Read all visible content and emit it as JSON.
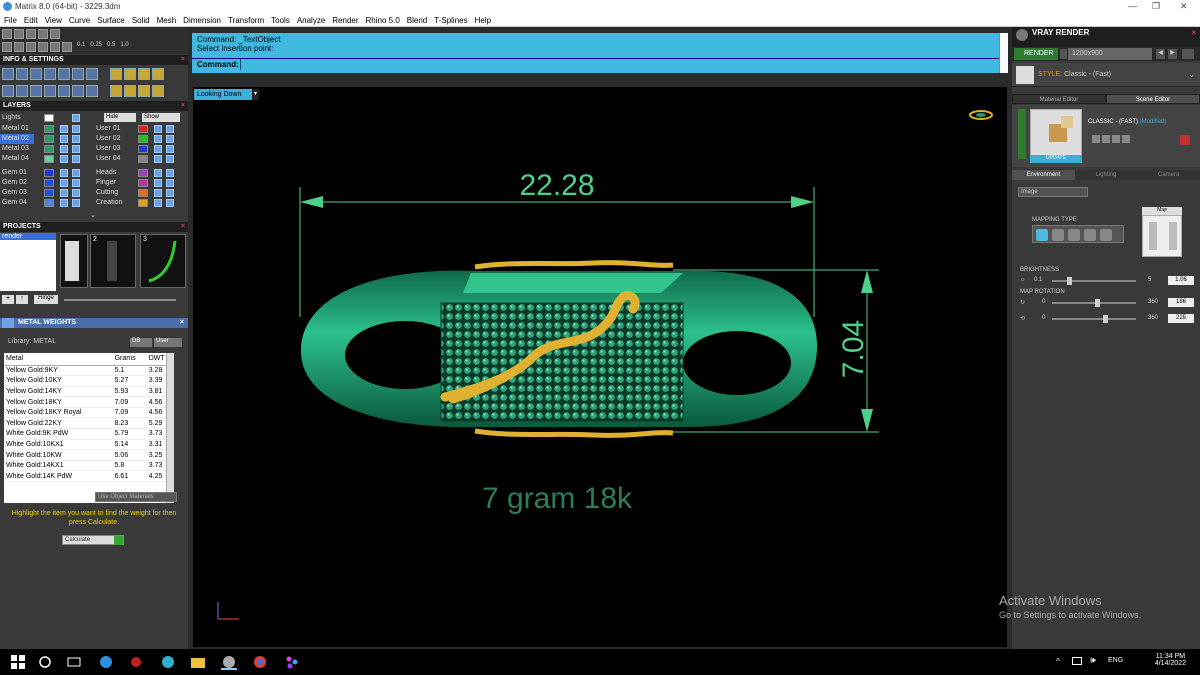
{
  "window": {
    "title": "Matrix 8.0 (64-bit) - 3229.3dm"
  },
  "menu": [
    "File",
    "Edit",
    "View",
    "Curve",
    "Surface",
    "Solid",
    "Mesh",
    "Dimension",
    "Transform",
    "Tools",
    "Analyze",
    "Render",
    "Rhino 5.0",
    "Blend",
    "T-Splines",
    "Help"
  ],
  "toolbar_values": [
    "0.1",
    "0.25",
    "0.5",
    "1.0"
  ],
  "info_panel": {
    "title": "INFO & SETTINGS"
  },
  "layers": {
    "title": "LAYERS",
    "header": [
      "Lights",
      "Hide",
      "Show"
    ],
    "rows": [
      {
        "left": "Metal 01",
        "right": "User 01",
        "lcolor": "#2e9a6a",
        "rcolor": "#e02020"
      },
      {
        "left": "Metal 02",
        "right": "User 02",
        "lcolor": "#2e9a6a",
        "rcolor": "#20c020",
        "selected": true
      },
      {
        "left": "Metal 03",
        "right": "User 03",
        "lcolor": "#2e9a6a",
        "rcolor": "#1e3adb"
      },
      {
        "left": "Metal 04",
        "right": "User 04",
        "lcolor": "#6ad0a0",
        "rcolor": "#888888"
      },
      {
        "left": "Gem 01",
        "right": "Heads",
        "lcolor": "#1e3adb",
        "rcolor": "#9a40c0"
      },
      {
        "left": "Gem 02",
        "right": "Finger",
        "lcolor": "#2050e0",
        "rcolor": "#c030a0"
      },
      {
        "left": "Gem 03",
        "right": "Cutting",
        "lcolor": "#2050e0",
        "rcolor": "#e07020"
      },
      {
        "left": "Gem 04",
        "right": "Creation",
        "lcolor": "#5080e0",
        "rcolor": "#e0a020"
      }
    ]
  },
  "projects": {
    "title": "PROJECTS",
    "items": [
      "render"
    ],
    "thumbs": [
      "1",
      "2",
      "3"
    ],
    "button": "Hinge"
  },
  "metal_weights": {
    "title": "METAL WEIGHTS",
    "library": "Library: METAL",
    "buttons": [
      "DB",
      "User"
    ],
    "columns": [
      "Metal",
      "Grams",
      "DWT"
    ],
    "rows": [
      [
        "Yellow Gold:9KY",
        "5.1",
        "3.28"
      ],
      [
        "Yellow Gold:10KY",
        "5.27",
        "3.39"
      ],
      [
        "Yellow Gold:14KY",
        "5.93",
        "3.81"
      ],
      [
        "Yellow Gold:18KY",
        "7.09",
        "4.56"
      ],
      [
        "Yellow Gold:18KY Royal",
        "7.09",
        "4.56"
      ],
      [
        "Yellow Gold:22KY",
        "8.23",
        "5.29"
      ],
      [
        "White Gold:9K PdW",
        "5.79",
        "3.73"
      ],
      [
        "White Gold:10KX1",
        "5.14",
        "3.31"
      ],
      [
        "White Gold:10KW",
        "5.06",
        "3.25"
      ],
      [
        "White Gold:14KX1",
        "5.8",
        "3.73"
      ],
      [
        "White Gold:14K PdW",
        "6.61",
        "4.25"
      ]
    ],
    "use_object_materials": "Use Object Materials",
    "hint": "Highlight the item you want to find the weight for then press Calculate.",
    "calculate": "Calculate"
  },
  "command": {
    "line1": "Command: _TextObject",
    "line2": "Select insertion point:",
    "label": "Command:",
    "value": ""
  },
  "viewport": {
    "tab": "Looking Down",
    "dim_width": "22.28",
    "dim_height": "7.04",
    "annotation": "7 gram 18k"
  },
  "vray": {
    "title": "VRAY RENDER",
    "render_btn": "RENDER",
    "resolution": "1200x900",
    "style_label": "STYLE:",
    "style_value": "Classic - (Fast)",
    "tabs": [
      "Material Editor",
      "Scene Editor"
    ],
    "active_tab": "Scene Editor",
    "material_name": "CLASSIC - (FAST)",
    "material_state": "(Modified)",
    "update": "UPDATE",
    "env_tabs": [
      "Environment",
      "Lighting",
      "Camera"
    ],
    "env_type": "Image",
    "mapping_type": "MAPPING TYPE",
    "map_label": "Map",
    "brightness": {
      "label": "BRIGHTNESS",
      "min": "0.1",
      "max": "5",
      "value": "1.06"
    },
    "map_rotation": {
      "label": "MAP ROTATION",
      "min": "0",
      "max": "360",
      "value1": "186",
      "value2": "225"
    }
  },
  "watermark": {
    "line1": "Activate Windows",
    "line2": "Go to Settings to activate Windows."
  },
  "tray": {
    "lang": "ENG",
    "time": "11:34 PM",
    "date": "4/14/2022"
  },
  "colors": {
    "accent": "#40b8e0",
    "dim_green": "#4fd08a",
    "ring_green": "#1f9a6e",
    "gold": "#e0b030"
  }
}
